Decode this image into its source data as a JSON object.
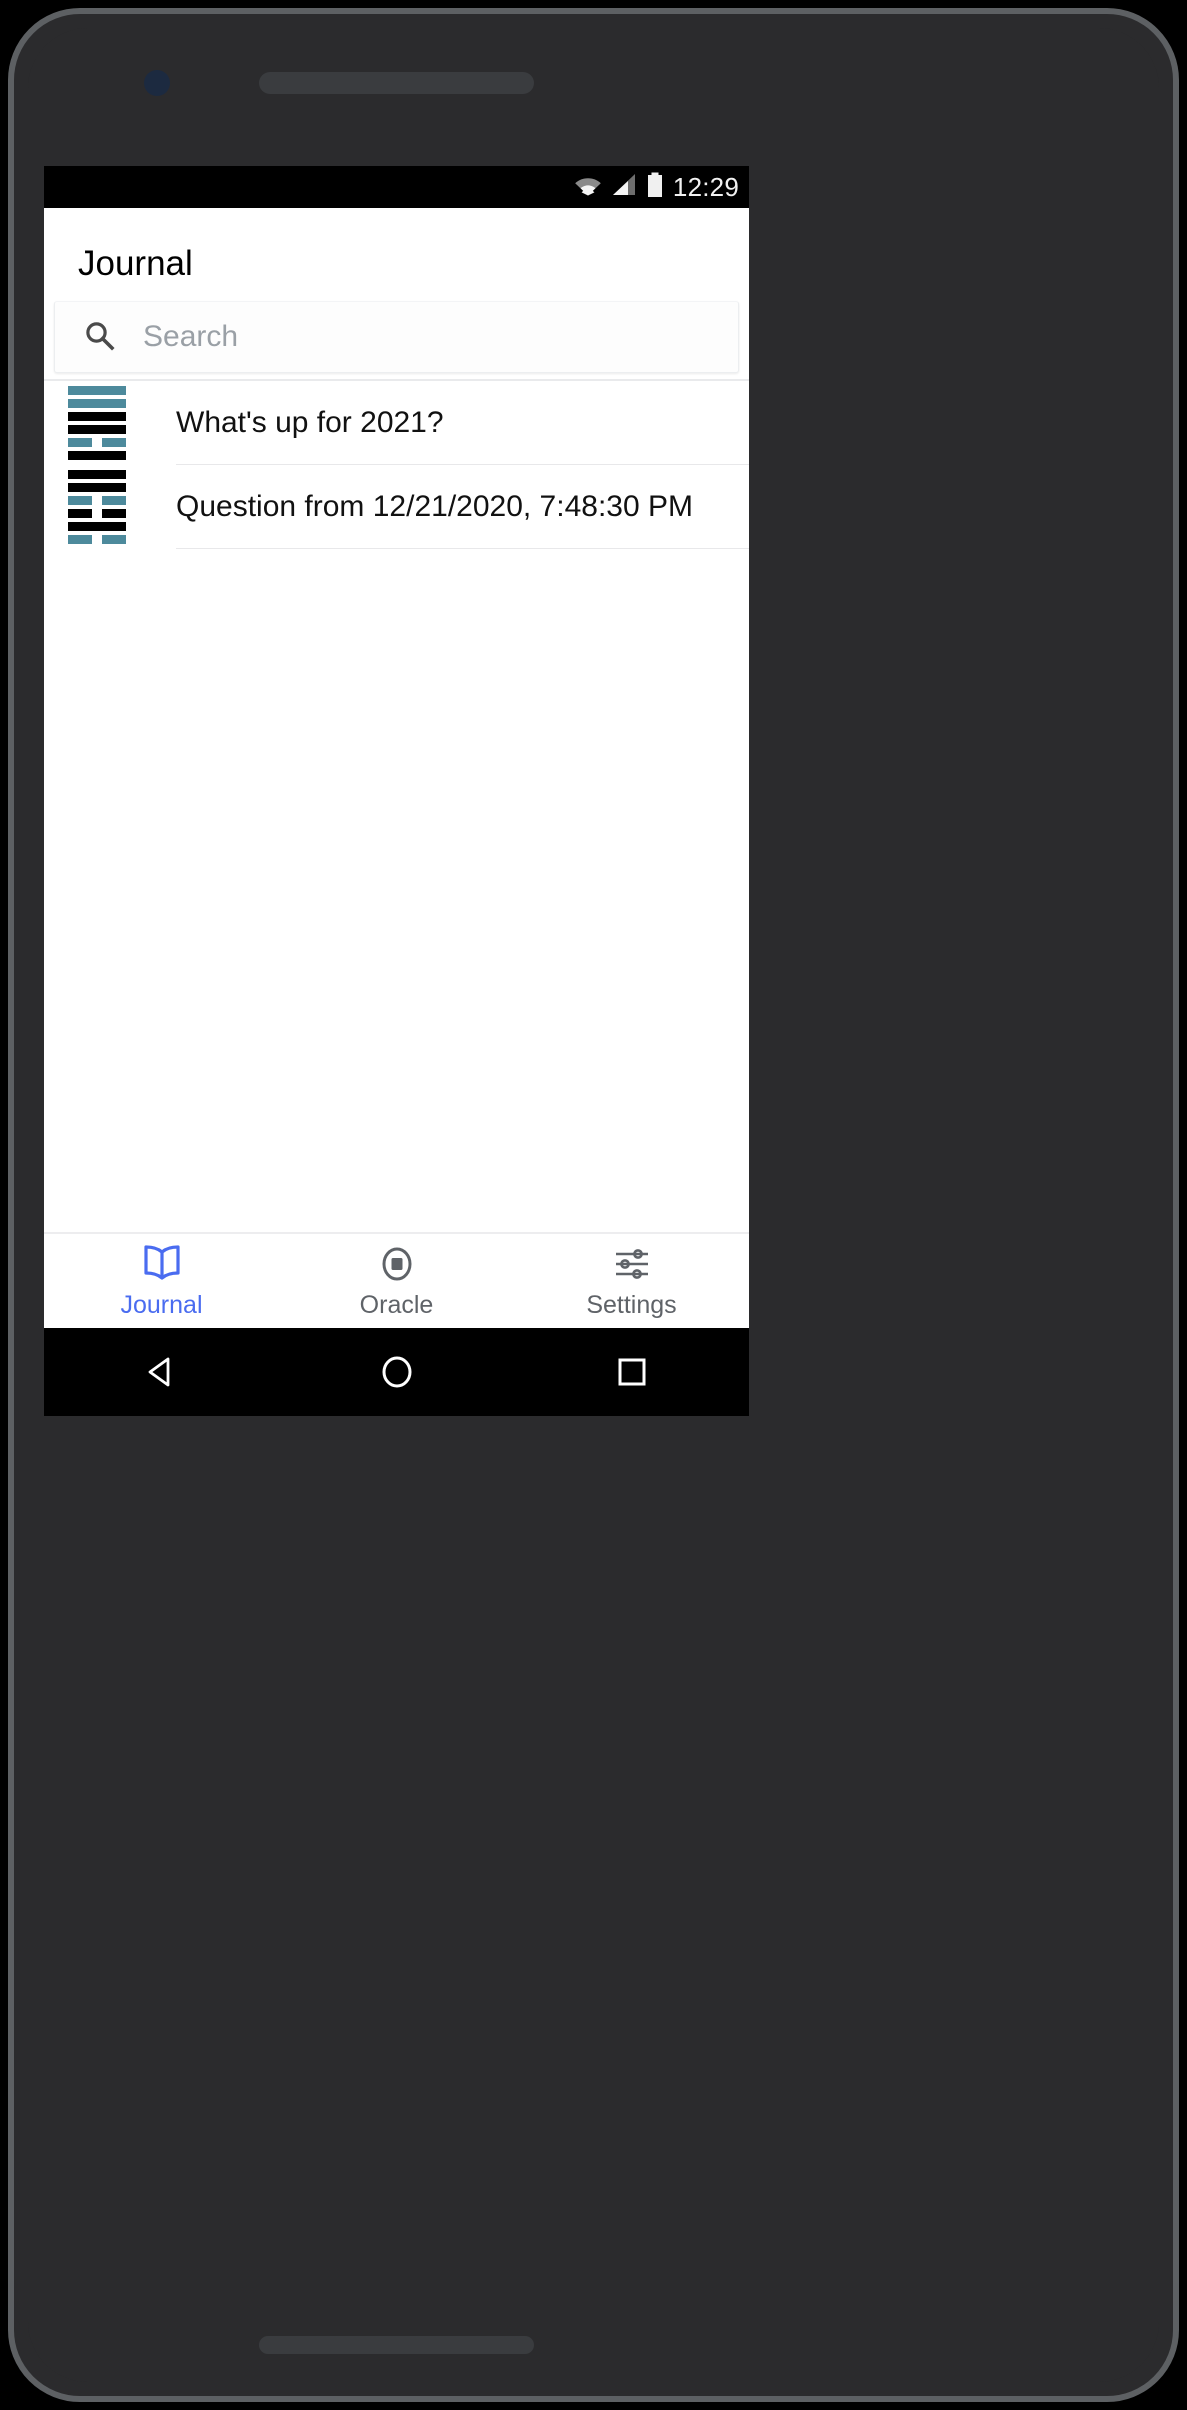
{
  "status_bar": {
    "clock": "12:29",
    "icons": [
      "wifi-icon",
      "cellular-signal-icon",
      "battery-icon"
    ]
  },
  "header": {
    "title": "Journal"
  },
  "search": {
    "icon": "search-icon",
    "placeholder": "Search",
    "value": ""
  },
  "journal": {
    "entries": [
      {
        "label": "What's up for 2021?",
        "icon": "hexagram-icon",
        "hexagram": [
          {
            "type": "solid",
            "color": "#4d8a9c"
          },
          {
            "type": "solid",
            "color": "#4d8a9c"
          },
          {
            "type": "solid",
            "color": "#000000"
          },
          {
            "type": "solid",
            "color": "#000000"
          },
          {
            "type": "broken",
            "color": "#4d8a9c"
          },
          {
            "type": "solid",
            "color": "#000000"
          }
        ]
      },
      {
        "label": "Question from 12/21/2020, 7:48:30 PM",
        "icon": "hexagram-icon",
        "hexagram": [
          {
            "type": "solid",
            "color": "#000000"
          },
          {
            "type": "solid",
            "color": "#000000"
          },
          {
            "type": "broken",
            "color": "#4d8a9c"
          },
          {
            "type": "broken",
            "color": "#000000"
          },
          {
            "type": "solid",
            "color": "#000000"
          },
          {
            "type": "broken",
            "color": "#4d8a9c"
          }
        ]
      }
    ]
  },
  "tab_bar": {
    "active_index": 0,
    "items": [
      {
        "label": "Journal",
        "icon": "open-book-icon",
        "active": true
      },
      {
        "label": "Oracle",
        "icon": "coin-circle-icon",
        "active": false
      },
      {
        "label": "Settings",
        "icon": "sliders-icon",
        "active": false
      }
    ]
  },
  "nav_bar": {
    "buttons": [
      "back-triangle-icon",
      "home-circle-icon",
      "recents-square-icon"
    ]
  },
  "colors": {
    "accent": "#4a6cf0",
    "hexagram_teal": "#4d8a9c",
    "hexagram_black": "#000000",
    "inactive_tab": "#5f6368",
    "placeholder": "#9aa0a6"
  }
}
